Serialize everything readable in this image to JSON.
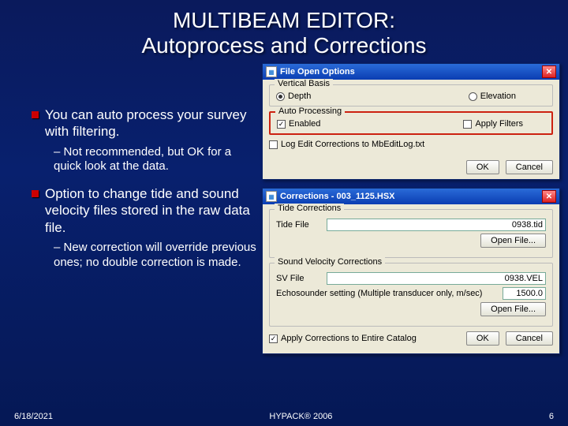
{
  "title_l1": "MULTIBEAM EDITOR:",
  "title_l2": "Autoprocess and Corrections",
  "bullets": {
    "b1": "You can auto process your survey with filtering.",
    "b1s": "Not recommended, but OK for a quick look at the data.",
    "b2": "Option to change tide and sound velocity files stored in the raw data file.",
    "b2s": "New correction will override previous ones; no double correction is made."
  },
  "footer": {
    "date": "6/18/2021",
    "center": "HYPACK® 2006",
    "num": "6"
  },
  "win1": {
    "title": "File Open Options",
    "grp_vb": "Vertical Basis",
    "opt_depth": "Depth",
    "opt_elev": "Elevation",
    "grp_ap": "Auto Processing",
    "chk_enabled": "Enabled",
    "chk_apply": "Apply Filters",
    "chk_log": "Log Edit Corrections to MbEditLog.txt",
    "ok": "OK",
    "cancel": "Cancel"
  },
  "win2": {
    "title": "Corrections - 003_1125.HSX",
    "grp_tide": "Tide Corrections",
    "lbl_tide": "Tide File",
    "val_tide": "0938.tid",
    "open": "Open File...",
    "grp_sv": "Sound Velocity Corrections",
    "lbl_sv": "SV File",
    "val_sv": "0938.VEL",
    "echos": "Echosounder setting (Multiple transducer only, m/sec)",
    "val_echos": "1500.0",
    "chk_apply_all": "Apply Corrections to Entire Catalog",
    "ok": "OK",
    "cancel": "Cancel"
  }
}
